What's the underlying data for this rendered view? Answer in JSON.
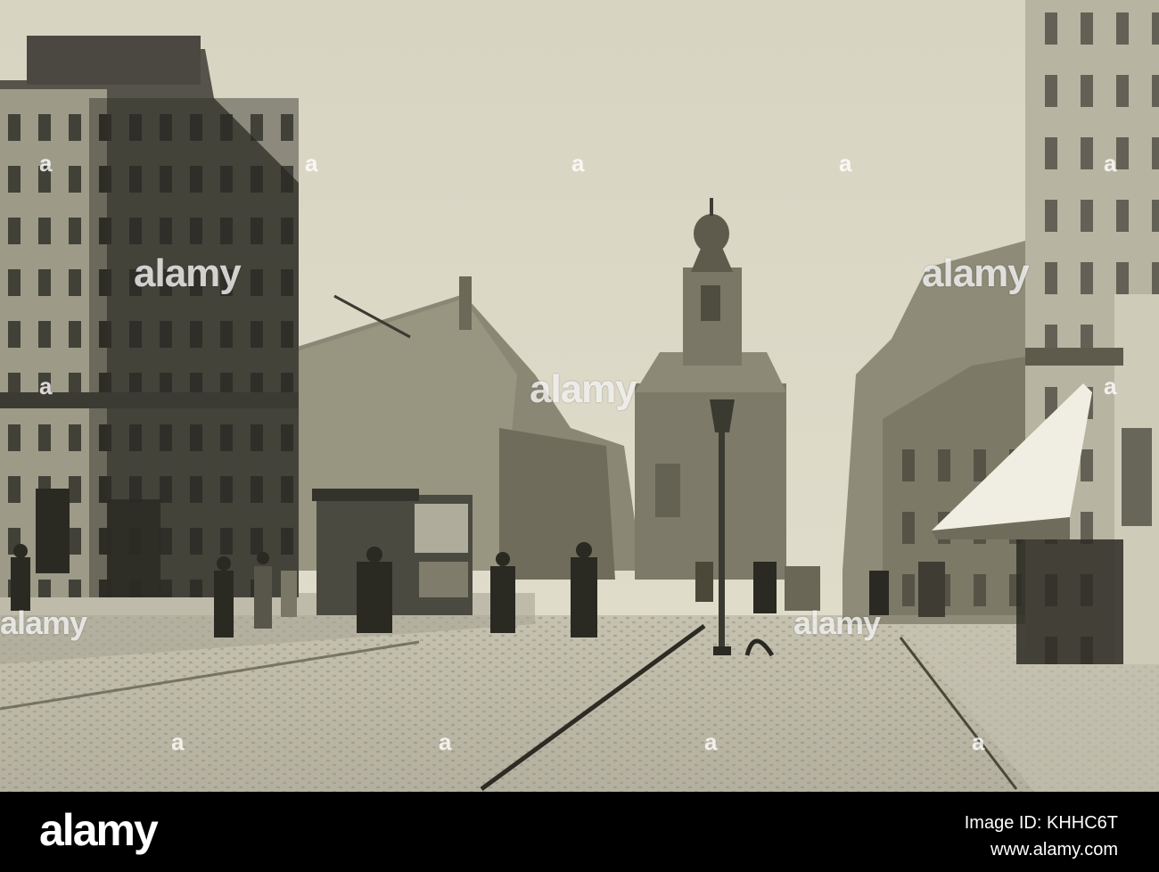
{
  "photo": {
    "subject": "historic-street-photograph",
    "palette": {
      "sky": "#dcd8c6",
      "building_dark": "#3b3a31",
      "building_mid": "#6b685b",
      "street": "#bdb9a8",
      "paper": "#d7d3c1"
    }
  },
  "watermark": {
    "text": "alamy",
    "mark": "a"
  },
  "footer": {
    "logo": "alamy",
    "image_id_line": "Image ID: KHHC6T",
    "url": "www.alamy.com",
    "background": "#000000",
    "text_color": "#ffffff"
  }
}
